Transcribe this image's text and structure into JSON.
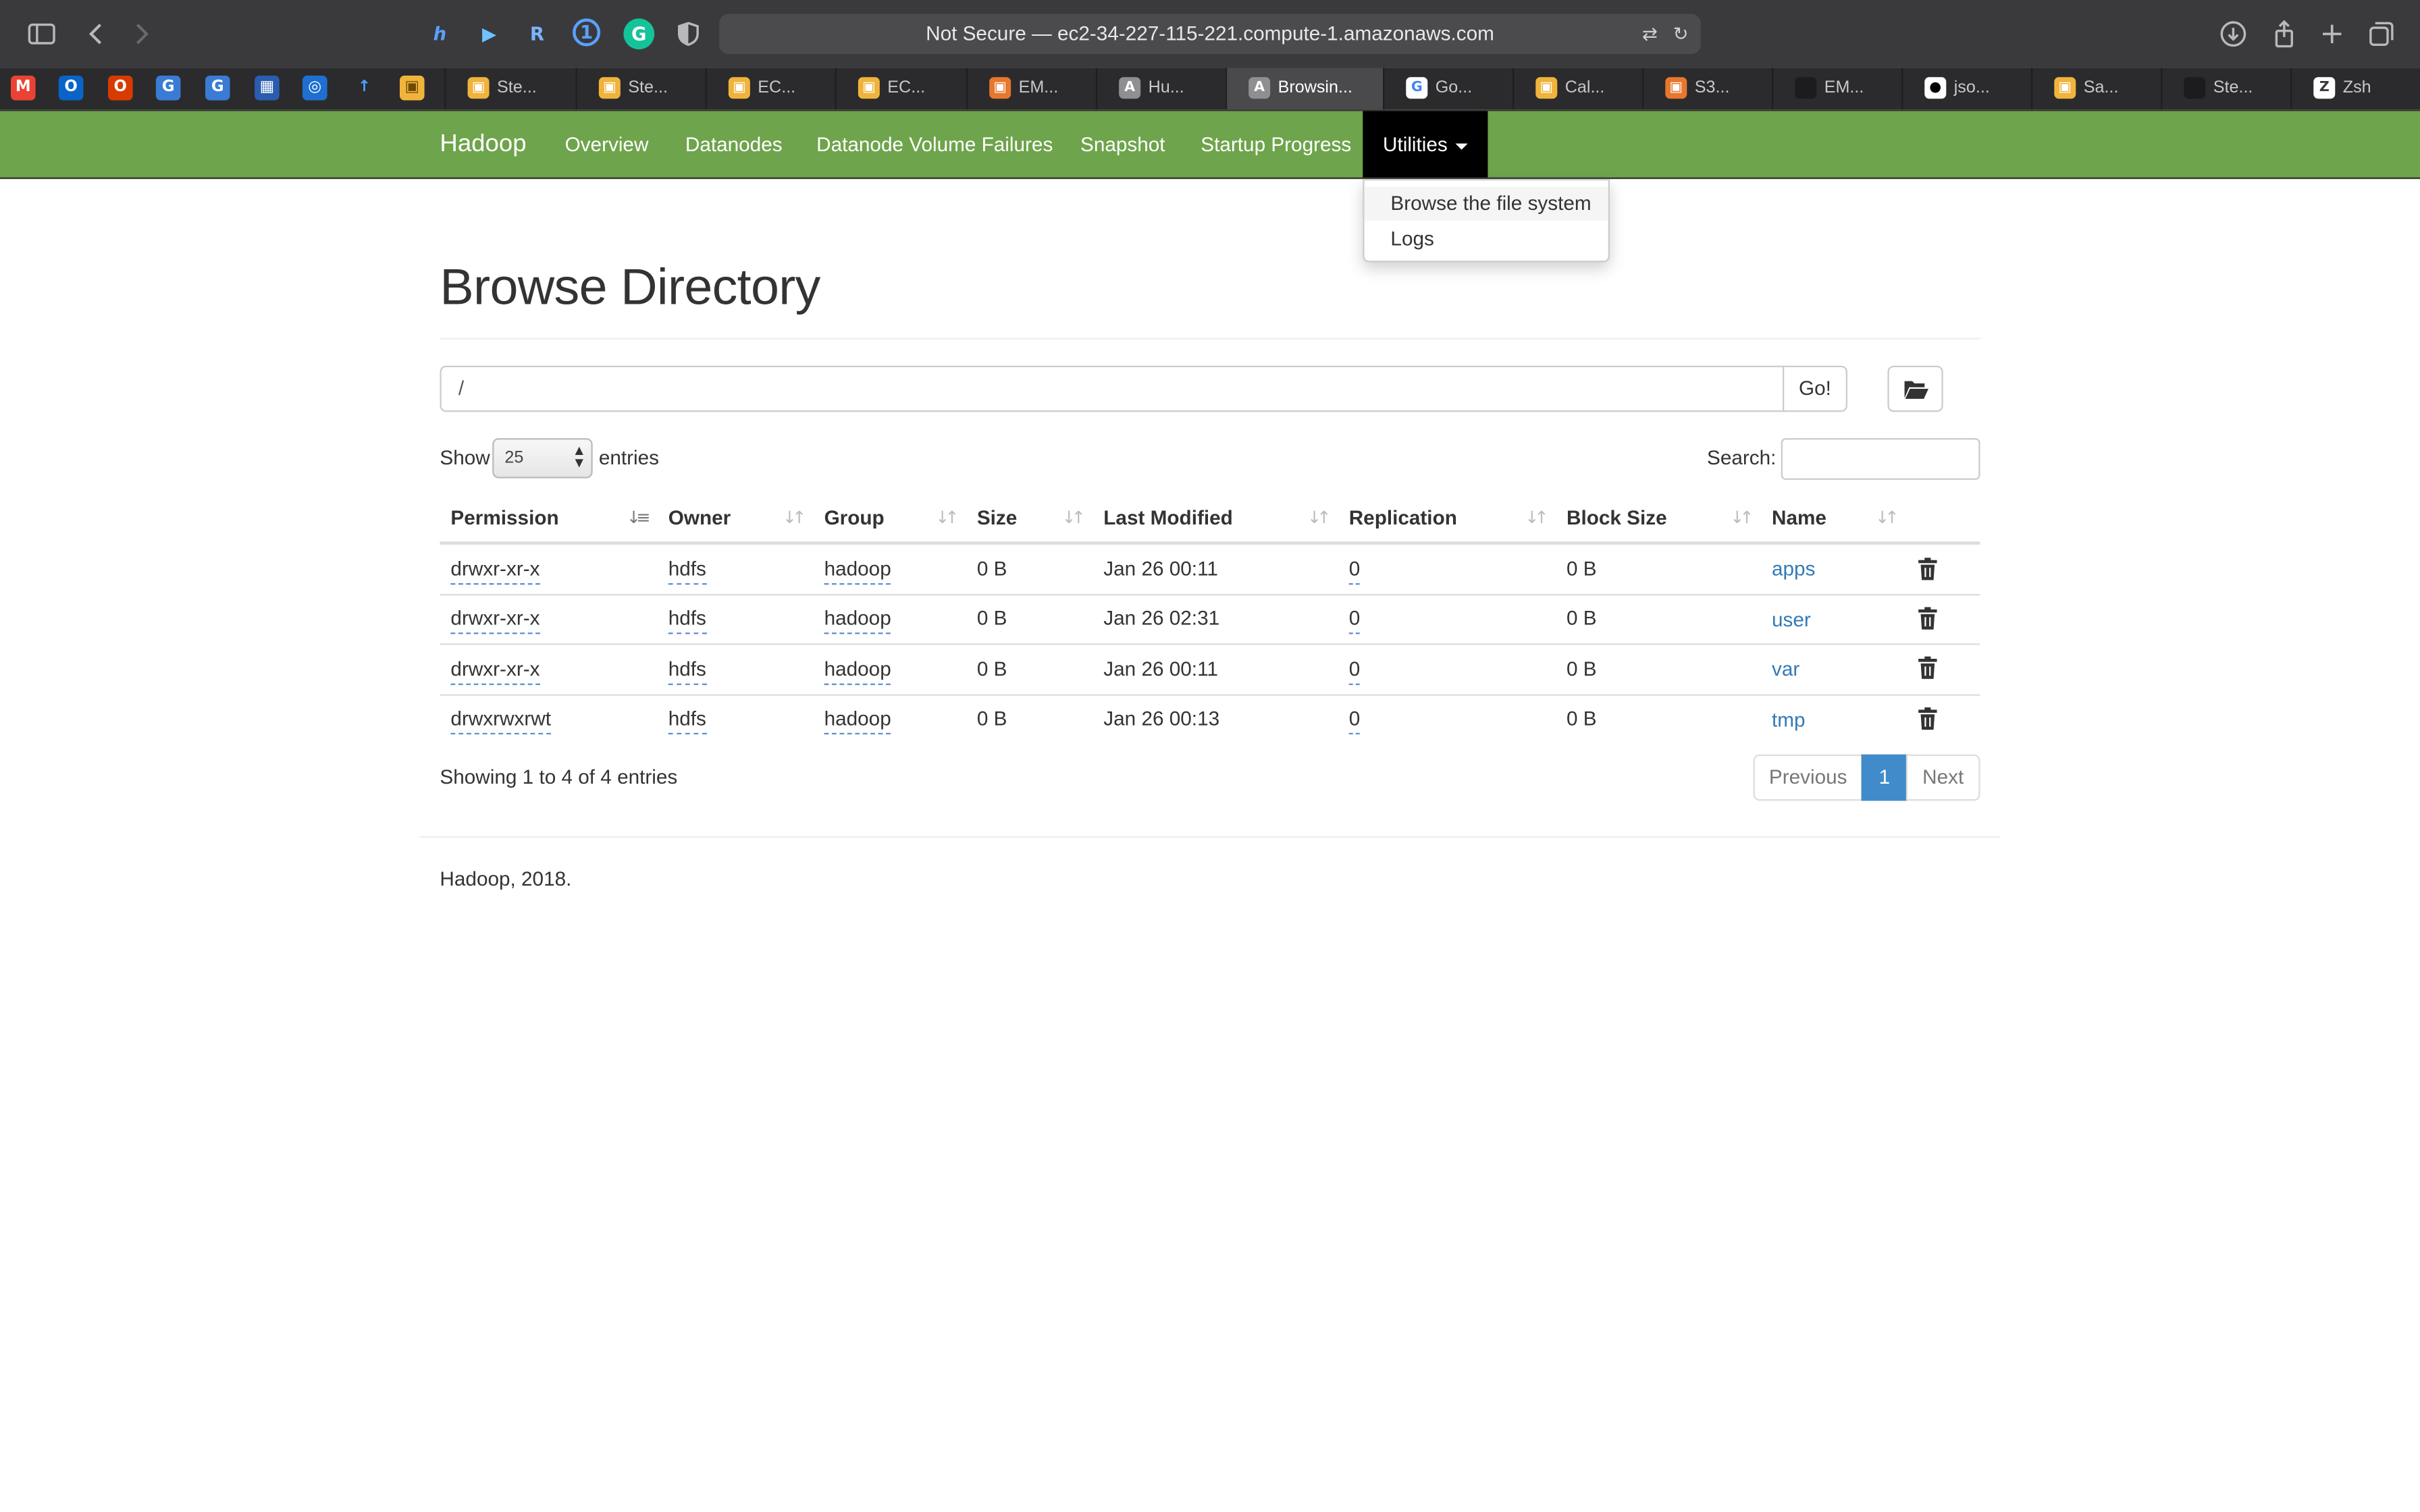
{
  "browser": {
    "url": "Not Secure — ec2-34-227-115-221.compute-1.amazonaws.com",
    "tabs": [
      {
        "label": "Ste..."
      },
      {
        "label": "Ste..."
      },
      {
        "label": "EC..."
      },
      {
        "label": "EC..."
      },
      {
        "label": "EM..."
      },
      {
        "label": "Hu..."
      },
      {
        "label": "Browsin..."
      },
      {
        "label": "Go..."
      },
      {
        "label": "Cal..."
      },
      {
        "label": "S3..."
      },
      {
        "label": "EM..."
      },
      {
        "label": "jso..."
      },
      {
        "label": "Sa..."
      },
      {
        "label": "Ste..."
      },
      {
        "label": "Zsh"
      }
    ]
  },
  "navbar": {
    "brand": "Hadoop",
    "links": [
      "Overview",
      "Datanodes",
      "Datanode Volume Failures",
      "Snapshot",
      "Startup Progress"
    ],
    "utilities": "Utilities",
    "dropdown": [
      "Browse the file system",
      "Logs"
    ]
  },
  "page": {
    "title": "Browse Directory",
    "path_value": "/",
    "go_label": "Go!",
    "show_label": "Show",
    "entries_label": "entries",
    "page_length": "25",
    "search_label": "Search:"
  },
  "table": {
    "headers": [
      "Permission",
      "Owner",
      "Group",
      "Size",
      "Last Modified",
      "Replication",
      "Block Size",
      "Name"
    ],
    "rows": [
      {
        "permission": "drwxr-xr-x",
        "owner": "hdfs",
        "group": "hadoop",
        "size": "0 B",
        "modified": "Jan 26 00:11",
        "replication": "0",
        "block": "0 B",
        "name": "apps"
      },
      {
        "permission": "drwxr-xr-x",
        "owner": "hdfs",
        "group": "hadoop",
        "size": "0 B",
        "modified": "Jan 26 02:31",
        "replication": "0",
        "block": "0 B",
        "name": "user"
      },
      {
        "permission": "drwxr-xr-x",
        "owner": "hdfs",
        "group": "hadoop",
        "size": "0 B",
        "modified": "Jan 26 00:11",
        "replication": "0",
        "block": "0 B",
        "name": "var"
      },
      {
        "permission": "drwxrwxrwt",
        "owner": "hdfs",
        "group": "hadoop",
        "size": "0 B",
        "modified": "Jan 26 00:13",
        "replication": "0",
        "block": "0 B",
        "name": "tmp"
      }
    ],
    "info": "Showing 1 to 4 of 4 entries",
    "pagination": {
      "previous": "Previous",
      "current": "1",
      "next": "Next"
    }
  },
  "footer": "Hadoop, 2018.",
  "colors": {
    "navbar": "#6ea44c",
    "link": "#337ab7",
    "page_active": "#428bca"
  }
}
